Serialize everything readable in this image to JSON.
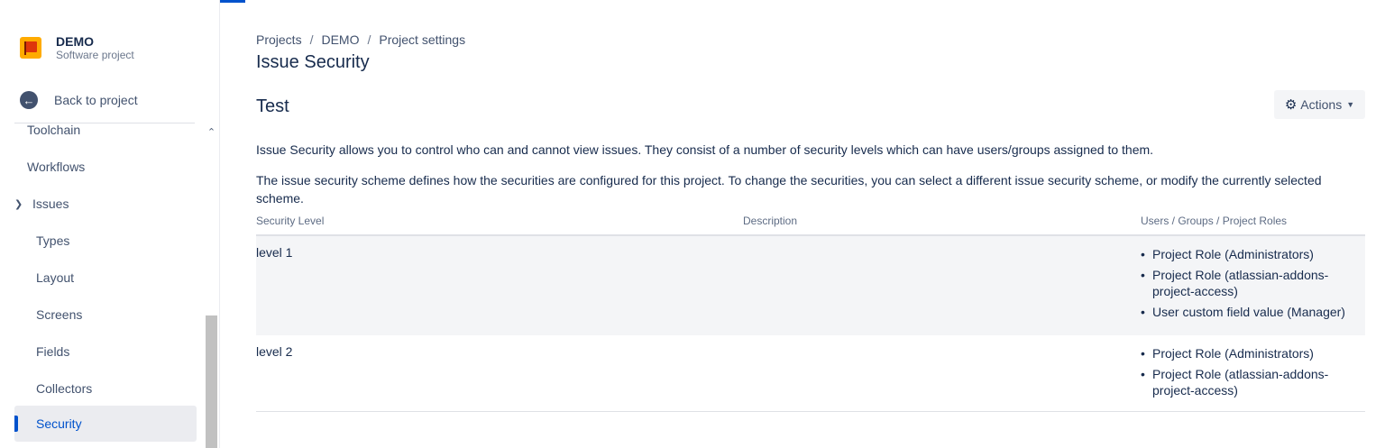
{
  "project": {
    "name": "DEMO",
    "type": "Software project"
  },
  "sidebar": {
    "back_label": "Back to project",
    "items": [
      {
        "label": "Toolchain"
      },
      {
        "label": "Workflows"
      },
      {
        "label": "Issues"
      },
      {
        "label": "Types"
      },
      {
        "label": "Layout"
      },
      {
        "label": "Screens"
      },
      {
        "label": "Fields"
      },
      {
        "label": "Collectors"
      },
      {
        "label": "Security"
      }
    ],
    "active_item": "Security"
  },
  "breadcrumb": [
    "Projects",
    "DEMO",
    "Project settings"
  ],
  "page_title": "Issue Security",
  "scheme_name": "Test",
  "actions_label": "Actions",
  "description": [
    "Issue Security allows you to control who can and cannot view issues. They consist of a number of security levels which can have users/groups assigned to them.",
    "The issue security scheme defines how the securities are configured for this project. To change the securities, you can select a different issue security scheme, or modify the currently selected scheme."
  ],
  "table": {
    "headers": [
      "Security Level",
      "Description",
      "Users / Groups / Project Roles"
    ],
    "rows": [
      {
        "level": "level 1",
        "description": "",
        "members": [
          "Project Role (Administrators)",
          "Project Role (atlassian-addons-project-access)",
          "User custom field value (Manager)"
        ]
      },
      {
        "level": "level 2",
        "description": "",
        "members": [
          "Project Role (Administrators)",
          "Project Role (atlassian-addons-project-access)"
        ]
      }
    ]
  },
  "colors": {
    "accent": "#0052cc",
    "active_bg": "#ebecf0",
    "row_highlight": "#f4f5f7"
  }
}
